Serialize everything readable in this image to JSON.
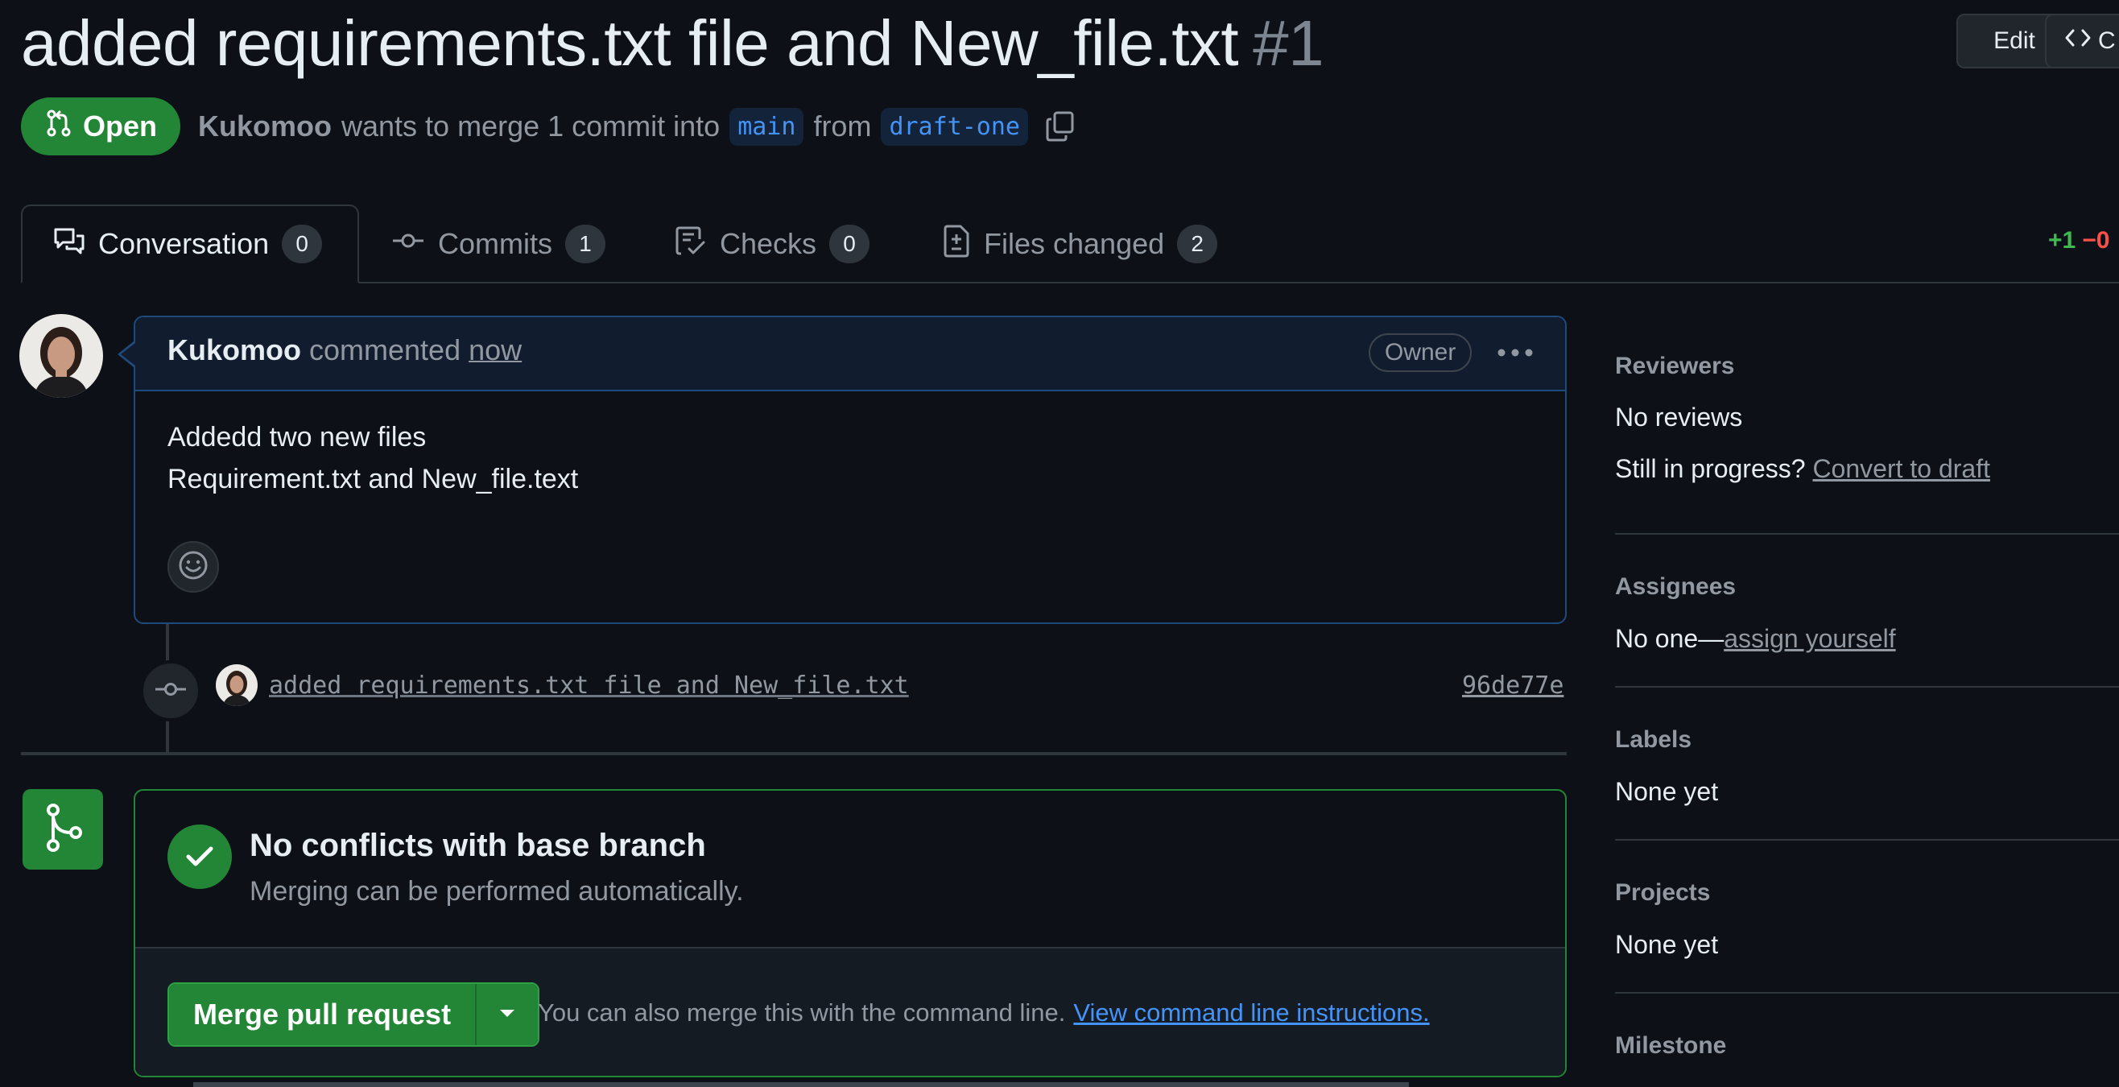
{
  "pr": {
    "title": "added requirements.txt file and New_file.txt",
    "number": "#1",
    "status": "Open",
    "author": "Kukomoo",
    "merge_text": "wants to merge 1 commit into",
    "base_branch": "main",
    "from_text": "from",
    "head_branch": "draft-one"
  },
  "header_actions": {
    "edit_label": "Edit",
    "code_label": "C"
  },
  "tabs": [
    {
      "label": "Conversation",
      "count": "0"
    },
    {
      "label": "Commits",
      "count": "1"
    },
    {
      "label": "Checks",
      "count": "0"
    },
    {
      "label": "Files changed",
      "count": "2"
    }
  ],
  "diffstat": {
    "additions": "+1",
    "deletions": "−0"
  },
  "comment": {
    "author": "Kukomoo",
    "action": "commented",
    "time": "now",
    "role": "Owner",
    "body_line1": "Addedd two new files",
    "body_line2": "Requirement.txt and New_file.text"
  },
  "commit": {
    "message": "added requirements.txt file and New_file.txt",
    "sha": "96de77e"
  },
  "merge": {
    "title": "No conflicts with base branch",
    "subtitle": "Merging can be performed automatically.",
    "button_label": "Merge pull request",
    "hint": "You can also merge this with the command line.",
    "hint_link": "View command line instructions."
  },
  "sidebar": {
    "reviewers_heading": "Reviewers",
    "reviewers_value": "No reviews",
    "in_progress_text": "Still in progress?",
    "convert_link": "Convert to draft",
    "assignees_heading": "Assignees",
    "assignees_prefix": "No one—",
    "assign_link": "assign yourself",
    "labels_heading": "Labels",
    "labels_value": "None yet",
    "projects_heading": "Projects",
    "projects_value": "None yet",
    "milestone_heading": "Milestone"
  },
  "colors": {
    "background": "#0d1117",
    "success": "#238636",
    "link": "#4493f8",
    "muted": "#9198a1",
    "comment_border": "#1f4a7d"
  }
}
